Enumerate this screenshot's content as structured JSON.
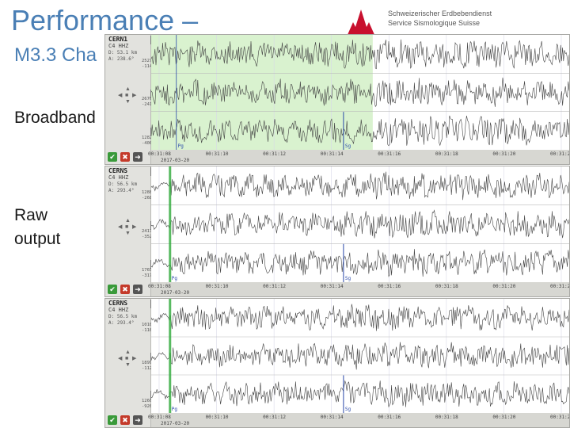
{
  "title": "Performance –",
  "subtitle": "M3.3 Cha",
  "labels": {
    "broadband": "Broadband",
    "raw_line1": "Raw",
    "raw_line2": "output"
  },
  "logo": {
    "line1": "Schweizerischer Erdbebendienst",
    "line2": "Service Sismologique Suisse",
    "color": "#c8102e"
  },
  "colors": {
    "title": "#4a7fb5",
    "pick_green": "#2faa3a",
    "phase_blue": "#2a4aaa",
    "highlight": "#d9f2cf"
  },
  "panels": [
    {
      "station": "CERN1",
      "channel": "C4  HHZ",
      "distance": "D: 53.1 km",
      "azimuth": "A: 238.6°",
      "amps": [
        "252735.3",
        "-11420.3",
        "267624.5",
        "-2410.5",
        "128234.6",
        "-400.1"
      ],
      "components": [
        "Z",
        "N",
        "E"
      ],
      "ticks": [
        "00:31:08",
        "00:31:10",
        "00:31:12",
        "00:31:14",
        "00:31:16",
        "00:31:18",
        "00:31:20",
        "00:31:22"
      ],
      "date": "2017-03-20",
      "phases": [
        "Pg",
        "Sg"
      ]
    },
    {
      "station": "CERNS",
      "channel": "C4  HHZ",
      "distance": "D: 56.5 km",
      "azimuth": "A: 293.4°",
      "amps": [
        "128890.9",
        "-2685.5",
        "241727.8",
        "-3523.8",
        "176573.7",
        "-3173.7"
      ],
      "components": [
        "Z",
        "N",
        "E"
      ],
      "ticks": [
        "00:31:08",
        "00:31:10",
        "00:31:12",
        "00:31:14",
        "00:31:16",
        "00:31:18",
        "00:31:20",
        "00:31:22"
      ],
      "date": "2017-03-20",
      "phases": [
        "Pg",
        "Sg"
      ]
    },
    {
      "station": "CERNS",
      "channel": "C4  HHZ",
      "distance": "D: 56.5 km",
      "azimuth": "A: 293.4°",
      "amps": [
        "101010.1",
        "-110307.1",
        "189928.9",
        "-11224.3",
        "126089.0",
        "-92028.0"
      ],
      "components": [
        "Z",
        "N",
        "E"
      ],
      "ticks": [
        "00:31:08",
        "00:31:10",
        "00:31:12",
        "00:31:14",
        "00:31:16",
        "00:31:18",
        "00:31:20",
        "00:31:22"
      ],
      "date": "2017-03-20",
      "phases": [
        "Pg",
        "Sg"
      ]
    }
  ]
}
